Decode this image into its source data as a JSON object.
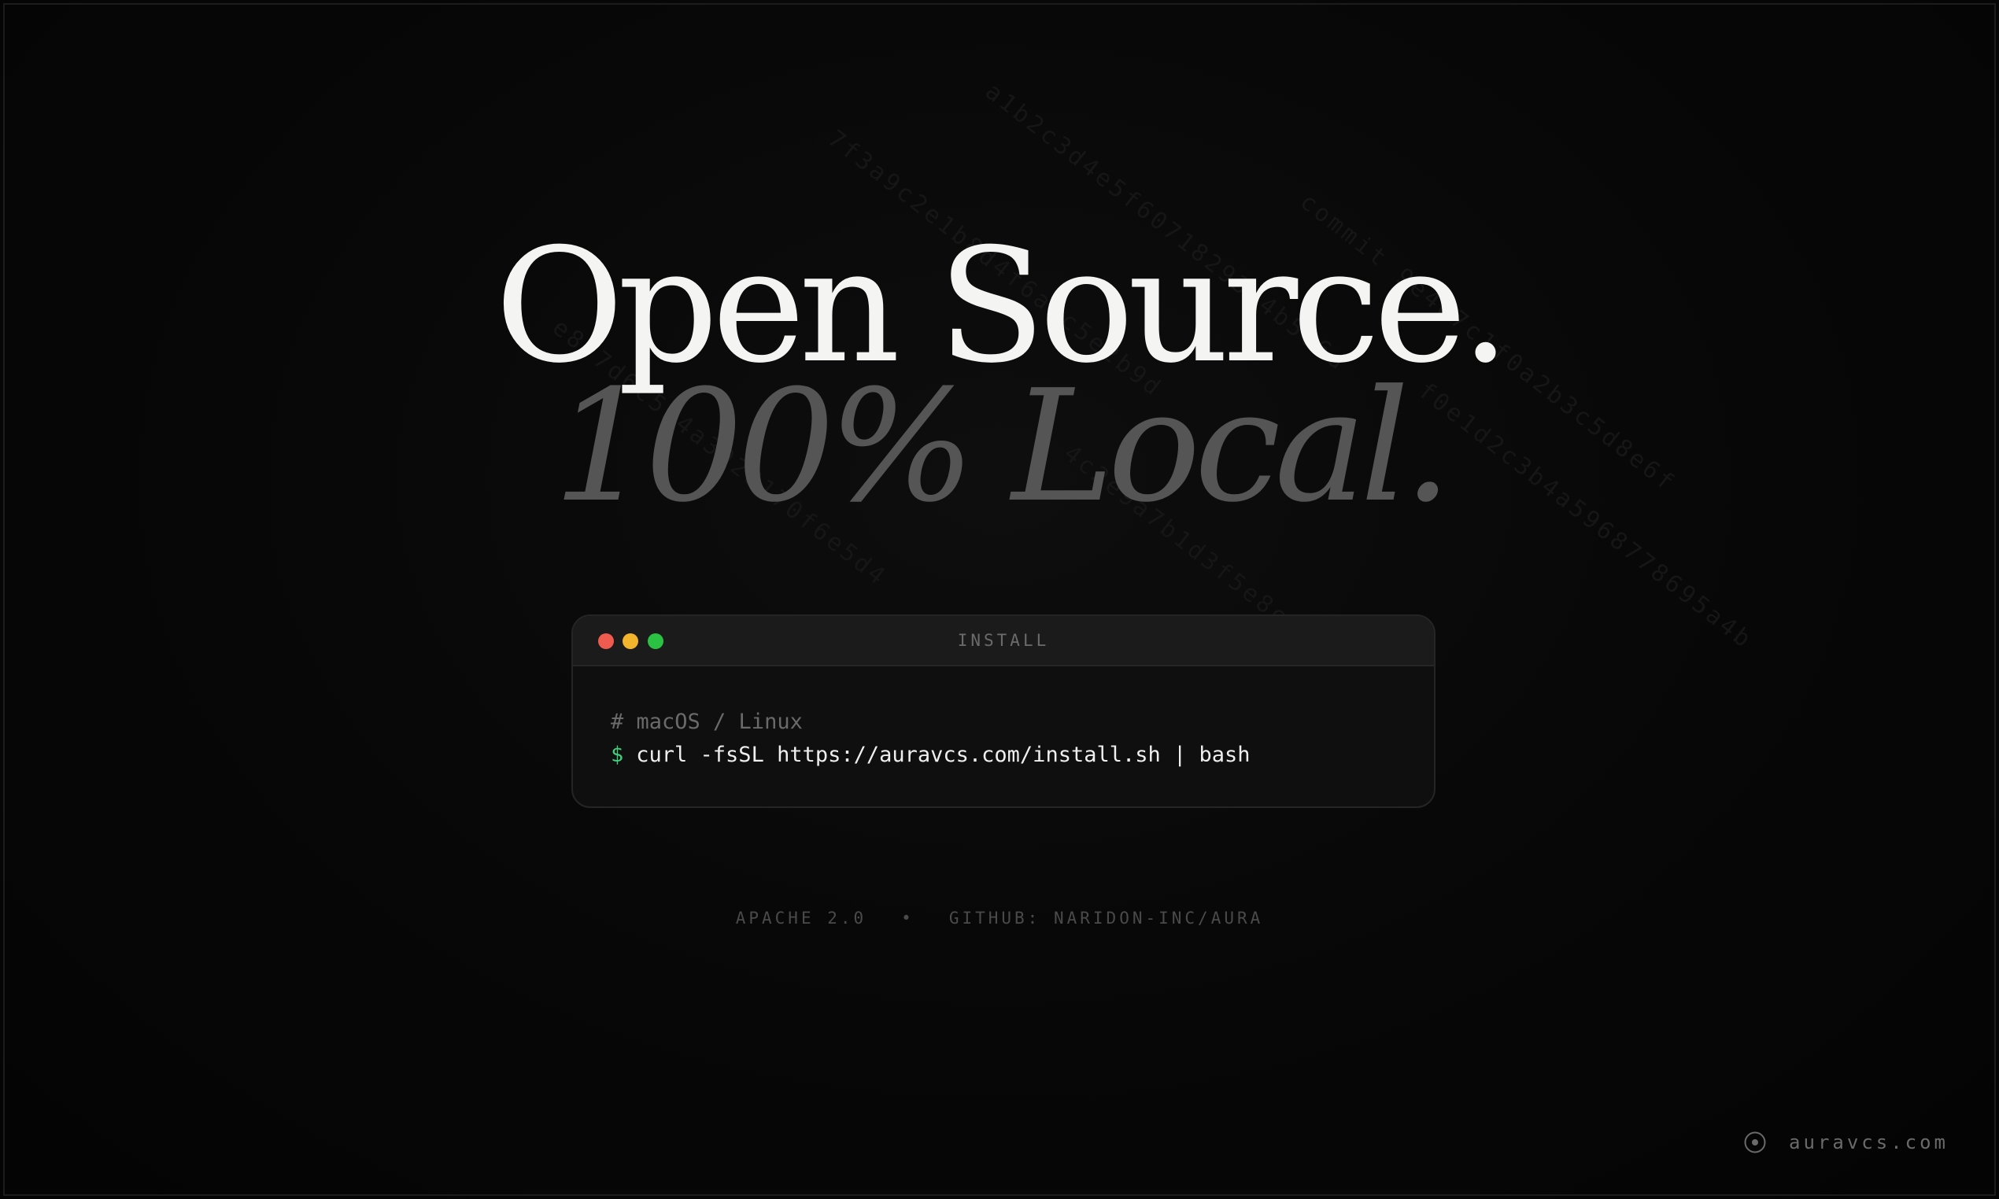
{
  "headline": "Open Source.",
  "subheadline": "100% Local.",
  "terminal": {
    "title": "INSTALL",
    "comment": "# macOS / Linux",
    "prompt": "$",
    "command": "curl -fsSL https://auravcs.com/install.sh | bash"
  },
  "footer": {
    "license": "APACHE 2.0",
    "separator": "•",
    "repo": "GITHUB: NARIDON-INC/AURA"
  },
  "brand": {
    "icon": "target-icon",
    "domain": "auravcs.com"
  },
  "background": {
    "streams": [
      "7f3a9c2e1b8d4f6a0c5e2b9d",
      "a1b2c3d4e5f60718293a4b5c6d",
      "commit 9e4d7c1f0a2b3c5d8e6f",
      "e8f7d6c5b4a3928170f6e5d4",
      "4c2e9a7b1d3f5e8c0a6b2d4f",
      "f0e1d2c3b4a5968778695a4b"
    ]
  }
}
